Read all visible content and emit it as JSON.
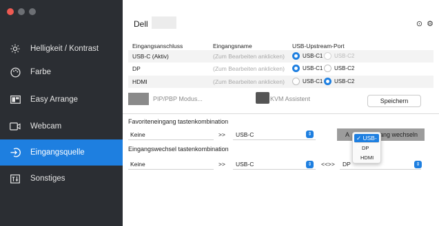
{
  "window": {
    "traffic_lights": [
      "close",
      "minimize",
      "zoom"
    ]
  },
  "sidebar": {
    "items": [
      {
        "label": "Helligkeit / Kontrast",
        "icon": "brightness-icon",
        "active": false
      },
      {
        "label": "Farbe",
        "icon": "palette-icon",
        "active": false
      },
      {
        "label": "Easy Arrange",
        "icon": "layout-icon",
        "active": false
      },
      {
        "label": "Webcam",
        "icon": "webcam-icon",
        "active": false
      },
      {
        "label": "Eingangsquelle",
        "icon": "input-source-icon",
        "active": true
      },
      {
        "label": "Sonstiges",
        "icon": "other-icon",
        "active": false
      }
    ]
  },
  "header": {
    "device": "Dell",
    "icons": [
      "info-icon",
      "settings-icon"
    ]
  },
  "input_table": {
    "headers": [
      "Eingangsanschluss",
      "Eingangsname",
      "USB-Upstream-Port"
    ],
    "rows": [
      {
        "port": "USB-C (Aktiv)",
        "name_hint": "(Zum Bearbeiten anklicken)",
        "usb1": "USB-C1",
        "usb2": "USB-C2",
        "selected": "USB-C1",
        "usb2_disabled": true
      },
      {
        "port": "DP",
        "name_hint": "(Zum Bearbeiten anklicken)",
        "usb1": "USB-C1",
        "usb2": "USB-C2",
        "selected": "USB-C1",
        "usb2_disabled": false
      },
      {
        "port": "HDMI",
        "name_hint": "(Zum Bearbeiten anklicken)",
        "usb1": "USB-C1",
        "usb2": "USB-C2",
        "selected": "USB-C2",
        "usb2_disabled": false
      }
    ]
  },
  "tools": {
    "pip_label": "PIP/PBP Modus...",
    "kvm_label": "KVM Assistent",
    "save_label": "Speichern"
  },
  "favorite": {
    "title": "Favoriteneingang tastenkombination",
    "key_value": "Keine",
    "arrow": ">>",
    "target": "USB-C",
    "switch_label_left": "A",
    "switch_label_right": "ang wechseln"
  },
  "switch_combo": {
    "title": "Eingangswechsel tastenkombination",
    "key_value": "Keine",
    "arrow": ">>",
    "first": "USB-C",
    "swap": "<<>>",
    "second": "DP"
  },
  "dropdown": {
    "options": [
      "USB-C",
      "DP",
      "HDMI"
    ],
    "selected": "USB-C",
    "check": "✓"
  },
  "colors": {
    "accent": "#1e7fe0",
    "sidebar": "#2b2e33"
  }
}
